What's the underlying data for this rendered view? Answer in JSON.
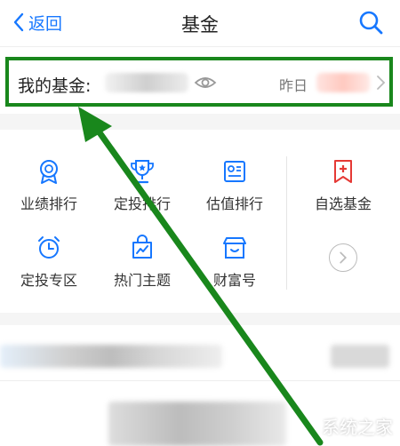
{
  "header": {
    "back_label": "返回",
    "title": "基金"
  },
  "my_fund": {
    "label": "我的基金:",
    "yesterday_label": "昨日"
  },
  "grid": {
    "items": [
      {
        "label": "业绩排行",
        "icon": "medal-icon"
      },
      {
        "label": "定投排行",
        "icon": "trophy-icon"
      },
      {
        "label": "估值排行",
        "icon": "certificate-icon"
      },
      {
        "label": "自选基金",
        "icon": "bookmark-plus-icon"
      },
      {
        "label": "定投专区",
        "icon": "alarm-clock-icon"
      },
      {
        "label": "热门主题",
        "icon": "trend-bag-icon"
      },
      {
        "label": "财富号",
        "icon": "storefront-icon"
      }
    ]
  },
  "colors": {
    "accent_blue": "#1677ff",
    "highlight_green": "#19871c",
    "bookmark_red": "#e53935"
  },
  "watermark": {
    "text": "系统之家"
  }
}
